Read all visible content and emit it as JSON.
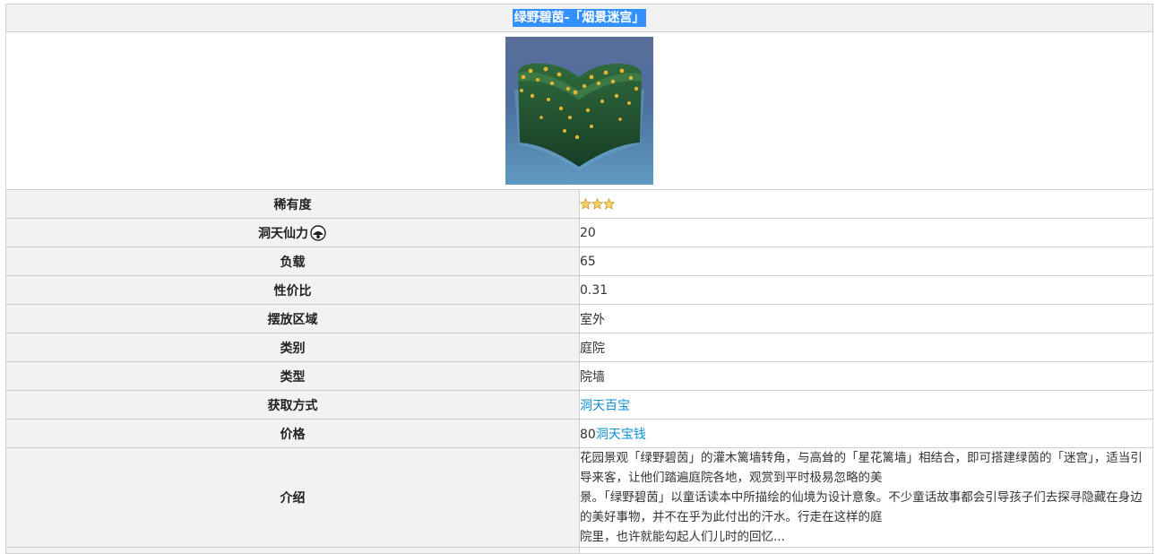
{
  "title": "绿野碧茵-「烟景迷宫」",
  "rows": {
    "rarity": {
      "label": "稀有度",
      "stars": 3
    },
    "adeptal_energy": {
      "label": "洞天仙力",
      "value": "20"
    },
    "load": {
      "label": "负载",
      "value": "65"
    },
    "cost_ratio": {
      "label": "性价比",
      "value": "0.31"
    },
    "placement": {
      "label": "摆放区域",
      "value": "室外"
    },
    "category": {
      "label": "类别",
      "value": "庭院"
    },
    "type": {
      "label": "类型",
      "value": "院墙"
    },
    "source": {
      "label": "获取方式",
      "link": "洞天百宝"
    },
    "price": {
      "label": "价格",
      "amount": "80",
      "currency_link": "洞天宝钱"
    },
    "intro": {
      "label": "介绍",
      "line1": "花园景观「绿野碧茵」的灌木篱墙转角，与高耸的「星花篱墙」相结合，即可搭建绿茵的「迷宫」，适当引导来客，让他们踏遍庭院各地，观赏到平时极易忽略的美",
      "line2": "景。「绿野碧茵」以童话读本中所描绘的仙境为设计意象。不少童话故事都会引导孩子们去探寻隐藏在身边的美好事物，并不在乎为此付出的汗水。行走在这样的庭",
      "line3": "院里，也许就能勾起人们儿时的回忆..."
    }
  },
  "icons": {
    "star": "star-icon",
    "adeptal": "adeptal-energy-icon"
  },
  "colors": {
    "link": "#0f8fd6",
    "title_highlight": "#3390ff",
    "label_bg": "#f2f2f2",
    "border": "#cfcfcf"
  }
}
